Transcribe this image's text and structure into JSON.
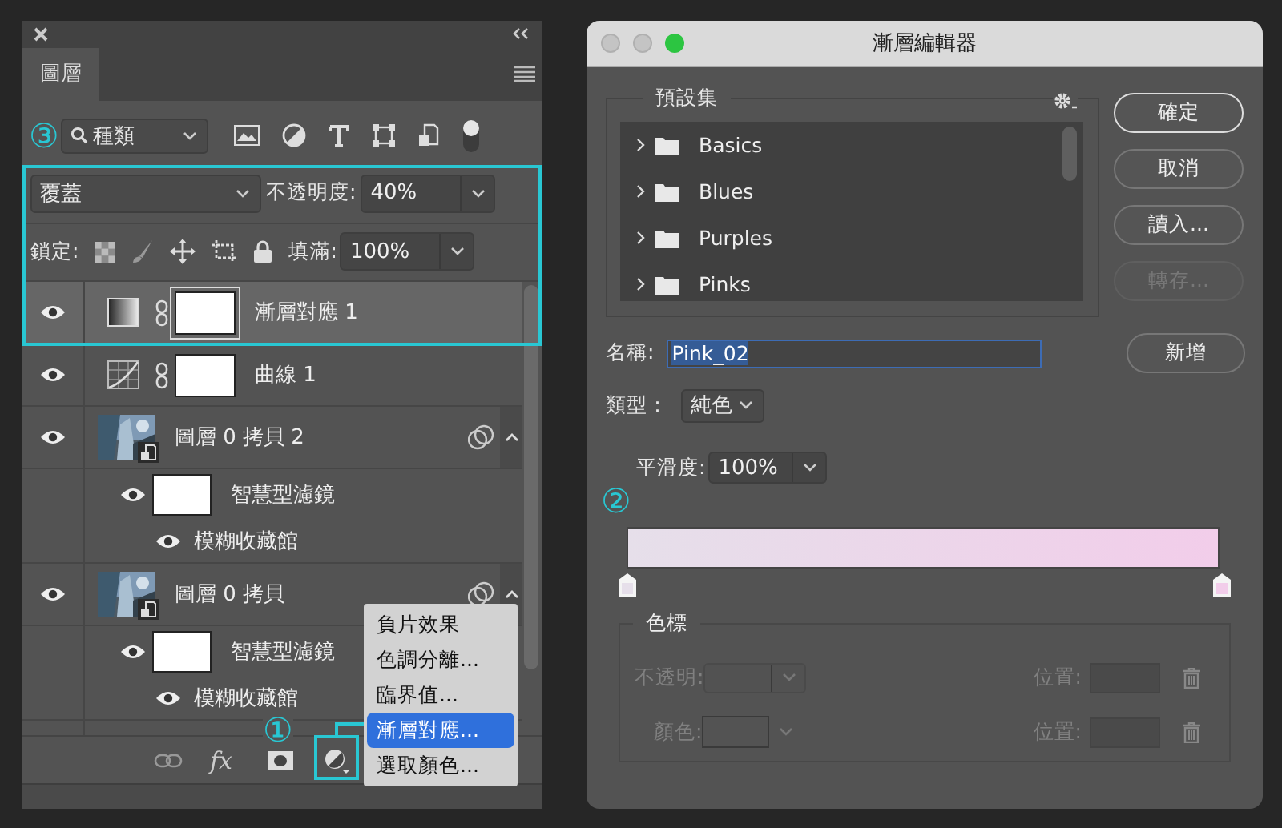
{
  "layers_panel": {
    "tab": {
      "label": "圖層",
      "selected": true
    },
    "filter": {
      "annotation": "③",
      "value": "種類",
      "on": true
    },
    "blend_mode": "覆蓋",
    "opacity_label": "不透明度:",
    "opacity": "40%",
    "lock_label": "鎖定:",
    "fill_label": "填滿:",
    "fill": "100%",
    "layers": [
      {
        "kind": "gradient_map",
        "name": "漸層對應 1",
        "visible": true,
        "selected": true
      },
      {
        "kind": "curves",
        "name": "曲線 1",
        "visible": true,
        "selected": false
      },
      {
        "kind": "smart_object",
        "name": "圖層 0 拷貝 2",
        "visible": true,
        "selected": false,
        "expanded": true,
        "children": [
          {
            "kind": "smart_filters",
            "name": "智慧型濾鏡",
            "visible": true,
            "children": [
              {
                "kind": "filter",
                "name": "模糊收藏館",
                "visible": true
              }
            ]
          }
        ]
      },
      {
        "kind": "smart_object",
        "name": "圖層 0 拷貝",
        "visible": true,
        "selected": false,
        "expanded": true,
        "children": [
          {
            "kind": "smart_filters",
            "name": "智慧型濾鏡",
            "visible": true,
            "children": [
              {
                "kind": "filter",
                "name": "模糊收藏館",
                "visible": true
              }
            ]
          }
        ]
      }
    ],
    "toolbar": {
      "fx_label": "fx",
      "annotation": "①"
    },
    "menu": [
      {
        "label": "負片效果",
        "selected": false
      },
      {
        "label": "色調分離...",
        "selected": false
      },
      {
        "label": "臨界值...",
        "selected": false
      },
      {
        "label": "漸層對應...",
        "selected": true
      },
      {
        "label": "選取顏色...",
        "selected": false
      }
    ]
  },
  "gradient_editor": {
    "title": "漸層編輯器",
    "presets": {
      "title": "預設集",
      "folders": [
        {
          "name": "Basics",
          "expanded": false
        },
        {
          "name": "Blues",
          "expanded": false
        },
        {
          "name": "Purples",
          "expanded": false
        },
        {
          "name": "Pinks",
          "expanded": false
        }
      ]
    },
    "buttons": [
      {
        "label": "確定",
        "default": true,
        "disabled": false
      },
      {
        "label": "取消",
        "default": false,
        "disabled": false
      },
      {
        "label": "讀入...",
        "default": false,
        "disabled": false
      },
      {
        "label": "轉存...",
        "default": false,
        "disabled": true
      }
    ],
    "name_field": {
      "label": "名稱:",
      "value": "Pink_02",
      "selected": true
    },
    "new_button": "新增",
    "type": {
      "label": "類型：",
      "value": "純色"
    },
    "smoothness": {
      "label": "平滑度:",
      "value": "100%"
    },
    "annotation": "②",
    "stops": [
      {
        "color": "#e6dfea"
      },
      {
        "color": "#f2cdea"
      }
    ],
    "color_stops": {
      "title": "色標",
      "disabled": true,
      "rows": [
        {
          "kind": "opacity",
          "label": "不透明:",
          "position_label": "位置:"
        },
        {
          "kind": "color",
          "label": "顏色:",
          "position_label": "位置:"
        }
      ]
    }
  }
}
